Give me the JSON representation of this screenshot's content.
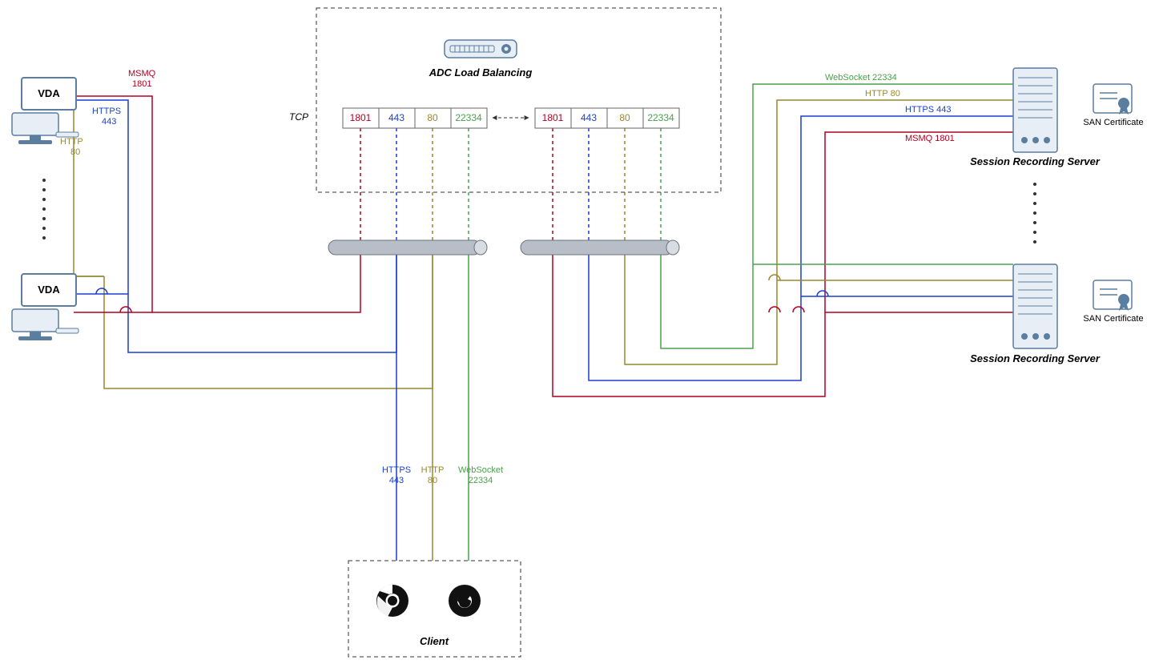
{
  "colors": {
    "red": "#b00020",
    "blue": "#1a3fd1",
    "olive": "#96892f",
    "green": "#4aa24a",
    "gray": "#9aa0a6",
    "darkgray": "#666666",
    "steel": "#5a7da0"
  },
  "adc": {
    "title": "ADC Load Balancing",
    "tcp_label": "TCP",
    "ports_left": [
      "1801",
      "443",
      "80",
      "22334"
    ],
    "ports_right": [
      "1801",
      "443",
      "80",
      "22334"
    ]
  },
  "vda": {
    "label": "VDA"
  },
  "protocols": {
    "msmq": {
      "name": "MSMQ",
      "port": "1801"
    },
    "https": {
      "name": "HTTPS",
      "port": "443"
    },
    "http": {
      "name": "HTTP",
      "port": "80"
    },
    "ws": {
      "name": "WebSocket",
      "port": "22334"
    }
  },
  "right_labels": {
    "ws": "WebSocket  22334",
    "http": "HTTP  80",
    "https": "HTTPS  443",
    "msmq": "MSMQ  1801"
  },
  "server": {
    "label": "Session Recording Server"
  },
  "cert": {
    "label": "SAN Certificate"
  },
  "client": {
    "label": "Client"
  },
  "client_protocols": {
    "https": {
      "name": "HTTPS",
      "port": "443"
    },
    "http": {
      "name": "HTTP",
      "port": "80"
    },
    "ws": {
      "name": "WebSocket",
      "port": "22334"
    }
  }
}
